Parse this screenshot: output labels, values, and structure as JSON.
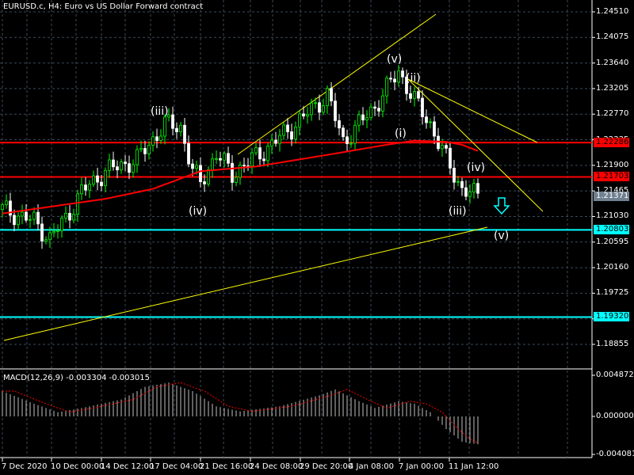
{
  "title": "EURUSD.c, H4:  Euro vs US Dollar Forward contract",
  "price_axis": [
    "1.24510",
    "1.24075",
    "1.23640",
    "1.23205",
    "1.22770",
    "1.22335",
    "1.21900",
    "1.21465",
    "1.21030",
    "1.20595",
    "1.20160",
    "1.19725",
    "1.19290",
    "1.18855"
  ],
  "price_tags": [
    {
      "value": "1.22286",
      "price": 1.22286,
      "color": "#ff0000",
      "text_color": "#000000"
    },
    {
      "value": "1.21703",
      "price": 1.21703,
      "color": "#ff0000",
      "text_color": "#000000"
    },
    {
      "value": "1.21371",
      "price": 1.21371,
      "color": "#708090",
      "text_color": "#ffffff"
    },
    {
      "value": "1.20803",
      "price": 1.20803,
      "color": "#00ffff",
      "text_color": "#000000"
    },
    {
      "value": "1.19320",
      "price": 1.1932,
      "color": "#00ffff",
      "text_color": "#000000"
    }
  ],
  "time_axis": [
    "7 Dec 2020",
    "10 Dec 00:00",
    "14 Dec 12:00",
    "17 Dec 04:00",
    "21 Dec 16:00",
    "24 Dec 08:00",
    "29 Dec 20:00",
    "4 Jan 08:00",
    "7 Jan 00:00",
    "11 Jan 12:00"
  ],
  "wave_labels": [
    "(v)",
    "(ii)",
    "(iii)",
    "(i)",
    "(iv)",
    "(iv)",
    "(iii)",
    "(v)"
  ],
  "macd": {
    "label": "MACD(12,26,9) -0.003304 -0.003015",
    "axis": [
      "0.004872",
      "0.000000",
      "-0.004081"
    ]
  },
  "colors": {
    "bull": "#00ff00",
    "bear": "#ffffff",
    "ma": "#ff0000",
    "trend": "#ffff00",
    "support": "#00ffff"
  },
  "chart_data": {
    "type": "candlestick",
    "symbol": "EURUSD.c",
    "timeframe": "H4",
    "ylim": [
      1.18855,
      1.2451
    ],
    "price_path": [
      [
        0,
        1.2115
      ],
      [
        8,
        1.2095
      ],
      [
        12,
        1.2065
      ],
      [
        16,
        1.21
      ],
      [
        20,
        1.2145
      ],
      [
        26,
        1.218
      ],
      [
        34,
        1.22
      ],
      [
        41,
        1.226
      ],
      [
        45,
        1.2255
      ],
      [
        48,
        1.218
      ],
      [
        50,
        1.216
      ],
      [
        54,
        1.221
      ],
      [
        58,
        1.2175
      ],
      [
        66,
        1.2215
      ],
      [
        74,
        1.226
      ],
      [
        82,
        1.231
      ],
      [
        86,
        1.223
      ],
      [
        94,
        1.229
      ],
      [
        100,
        1.235
      ],
      [
        104,
        1.23
      ],
      [
        108,
        1.226
      ],
      [
        112,
        1.22
      ],
      [
        116,
        1.215
      ],
      [
        120,
        1.2137
      ]
    ],
    "ma_path": [
      [
        0,
        1.2108
      ],
      [
        26,
        1.2133
      ],
      [
        38,
        1.215
      ],
      [
        50,
        1.218
      ],
      [
        64,
        1.2188
      ],
      [
        84,
        1.221
      ],
      [
        96,
        1.2224
      ],
      [
        104,
        1.2232
      ],
      [
        112,
        1.223
      ],
      [
        116,
        1.2225
      ],
      [
        121,
        1.2212
      ]
    ],
    "macd_hist": [
      [
        0,
        0.003
      ],
      [
        8,
        0.0015
      ],
      [
        14,
        0.0005
      ],
      [
        20,
        0.001
      ],
      [
        30,
        0.002
      ],
      [
        36,
        0.0035
      ],
      [
        42,
        0.004
      ],
      [
        48,
        0.003
      ],
      [
        54,
        0.0012
      ],
      [
        60,
        0.0006
      ],
      [
        70,
        0.0012
      ],
      [
        80,
        0.0025
      ],
      [
        84,
        0.0032
      ],
      [
        90,
        0.0018
      ],
      [
        94,
        0.001
      ],
      [
        100,
        0.0018
      ],
      [
        104,
        0.0015
      ],
      [
        108,
        0.0005
      ],
      [
        112,
        -0.0015
      ],
      [
        116,
        -0.003
      ],
      [
        120,
        -0.0033
      ]
    ]
  }
}
